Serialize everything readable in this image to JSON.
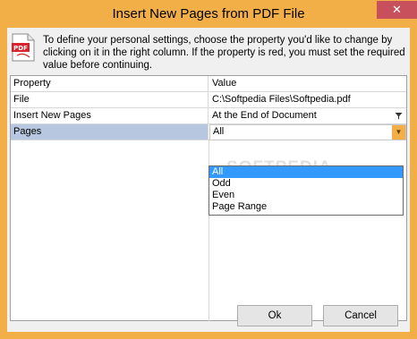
{
  "window": {
    "title": "Insert New Pages from PDF File",
    "close_glyph": "✕",
    "accent_color": "#f3af47"
  },
  "info": {
    "icon": "pdf-file-icon",
    "icon_label": "PDF",
    "text": "To define your personal settings, choose the property you'd like to change by clicking on it in the right column. If the property is red, you must set the required value before continuing."
  },
  "grid": {
    "headers": {
      "property": "Property",
      "value": "Value"
    },
    "rows": [
      {
        "property": "File",
        "value": "C:\\Softpedia Files\\Softpedia.pdf"
      },
      {
        "property": "Insert New Pages",
        "value": "At the End of Document"
      },
      {
        "property": "Pages",
        "value": "All"
      }
    ],
    "selected_row": 2,
    "dropdown_options": [
      "All",
      "Odd",
      "Even",
      "Page Range"
    ],
    "highlighted_option": "All"
  },
  "watermark": "SOFTPEDIA",
  "buttons": {
    "ok": "Ok",
    "cancel": "Cancel"
  }
}
